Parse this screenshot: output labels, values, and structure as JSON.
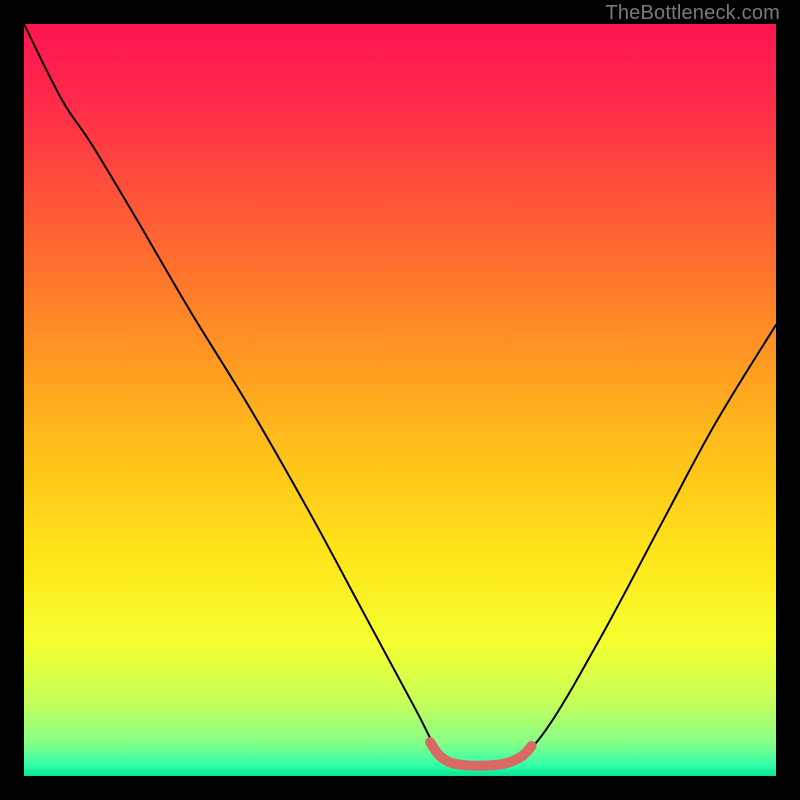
{
  "watermark": "TheBottleneck.com",
  "gradient_stops": [
    {
      "offset": 0.0,
      "color": "#ff1451"
    },
    {
      "offset": 0.1,
      "color": "#ff2a4a"
    },
    {
      "offset": 0.25,
      "color": "#ff5a36"
    },
    {
      "offset": 0.4,
      "color": "#ff8a26"
    },
    {
      "offset": 0.55,
      "color": "#ffbb1b"
    },
    {
      "offset": 0.7,
      "color": "#ffe319"
    },
    {
      "offset": 0.82,
      "color": "#f5ff2f"
    },
    {
      "offset": 0.9,
      "color": "#c7ff58"
    },
    {
      "offset": 0.955,
      "color": "#87ff86"
    },
    {
      "offset": 0.985,
      "color": "#34ffa9"
    },
    {
      "offset": 1.0,
      "color": "#06e695"
    }
  ],
  "chart_data": {
    "type": "line",
    "title": "",
    "xlabel": "",
    "ylabel": "",
    "xlim": [
      0,
      100
    ],
    "ylim": [
      0,
      100
    ],
    "series": [
      {
        "name": "bottleneck-curve",
        "x": [
          0,
          5,
          9,
          15,
          22,
          30,
          38,
          45,
          52,
          55.5,
          58,
          63,
          66,
          70,
          77,
          85,
          92,
          100
        ],
        "values": [
          100,
          90,
          84,
          74,
          62,
          49,
          35,
          22,
          9,
          2.5,
          1.5,
          1.5,
          2.5,
          7,
          19,
          34,
          47,
          60
        ]
      }
    ],
    "annotation": {
      "name": "optimal-zone",
      "x": [
        54,
        55.5,
        58,
        63,
        66,
        67.5
      ],
      "values": [
        4.5,
        2.5,
        1.5,
        1.5,
        2.5,
        4.0
      ]
    }
  }
}
